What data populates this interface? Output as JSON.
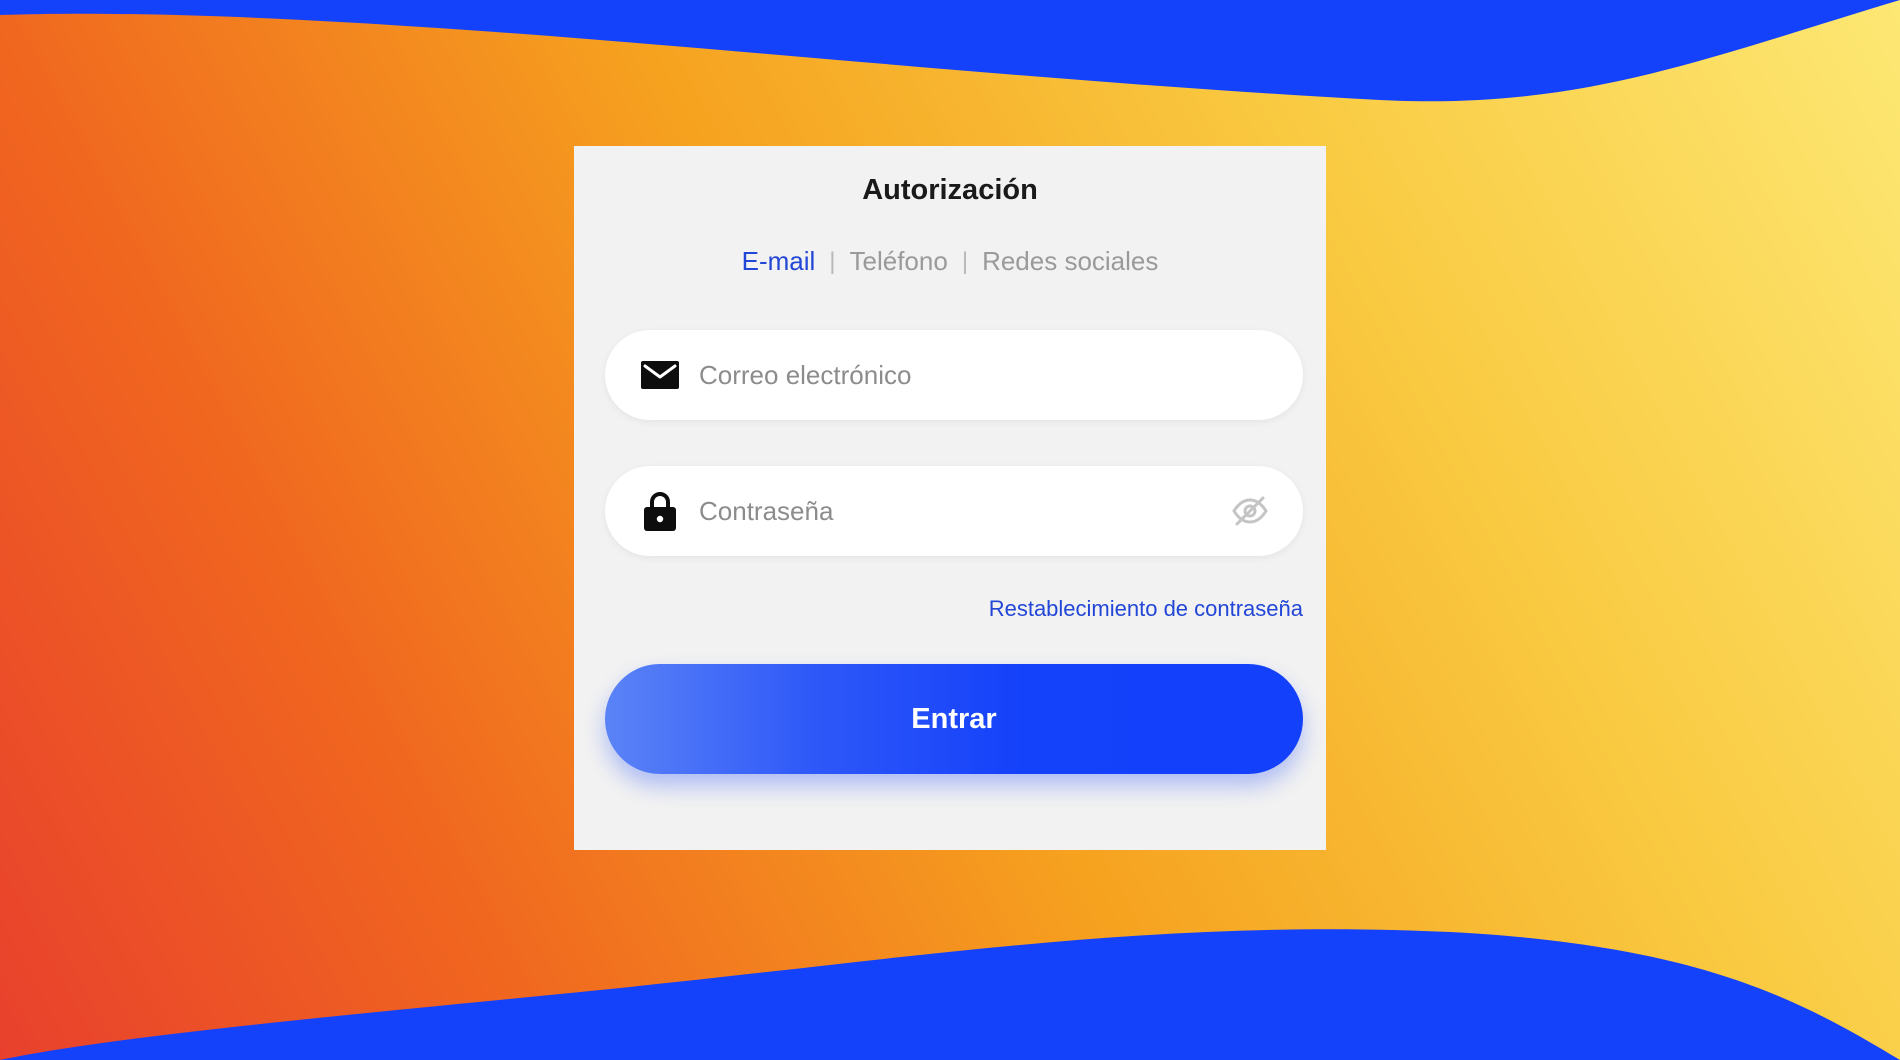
{
  "colors": {
    "accent_blue": "#1441fa",
    "link_blue": "#2246d6",
    "card_bg": "#f2f2f2",
    "gradient_left": "#e8402d",
    "gradient_right": "#fde874"
  },
  "auth": {
    "title": "Autorización",
    "tabs": [
      {
        "label": "E-mail",
        "active": true
      },
      {
        "label": "Teléfono",
        "active": false
      },
      {
        "label": "Redes sociales",
        "active": false
      }
    ],
    "tab_separator": "|",
    "email": {
      "placeholder": "Correo electrónico",
      "value": "",
      "icon": "mail-icon"
    },
    "password": {
      "placeholder": "Contraseña",
      "value": "",
      "icon": "lock-icon",
      "toggle_icon": "eye-off-icon"
    },
    "reset_link": "Restablecimiento de contraseña",
    "submit_label": "Entrar"
  }
}
